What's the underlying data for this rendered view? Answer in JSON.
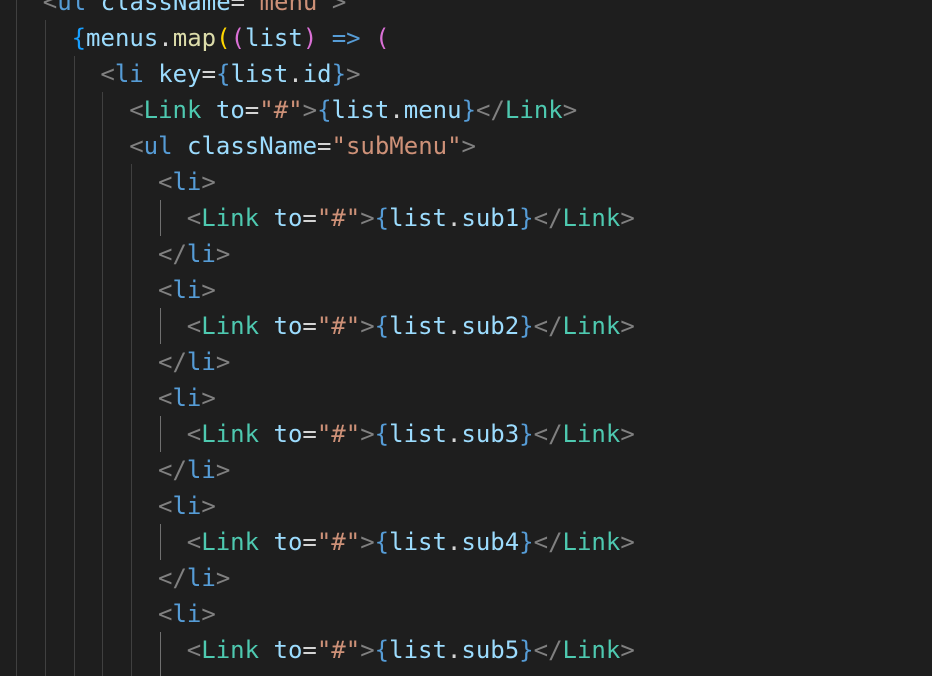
{
  "colors": {
    "background": "#1e1e1e",
    "tag_bracket": "#808080",
    "tag_name": "#569cd6",
    "component": "#4ec9b0",
    "attribute": "#9cdcfe",
    "string": "#ce9178",
    "punctuation": "#d4d4d4",
    "jsx_brace": "#569cd6",
    "bracket_gold": "#ffd700",
    "bracket_pink": "#da70d6",
    "bracket_blue": "#179fff",
    "function": "#dcdcaa"
  },
  "code_lines": [
    {
      "indent": 1,
      "tokens": [
        {
          "t": "<",
          "c": "tag_bracket"
        },
        {
          "t": "ul",
          "c": "tag_name"
        },
        {
          "t": " ",
          "c": "punctuation"
        },
        {
          "t": "className",
          "c": "attribute"
        },
        {
          "t": "=",
          "c": "punctuation"
        },
        {
          "t": "\"menu\"",
          "c": "string"
        },
        {
          "t": ">",
          "c": "tag_bracket"
        }
      ]
    },
    {
      "indent": 2,
      "tokens": [
        {
          "t": "{",
          "c": "bracket_blue"
        },
        {
          "t": "menus",
          "c": "attribute"
        },
        {
          "t": ".",
          "c": "punctuation"
        },
        {
          "t": "map",
          "c": "function"
        },
        {
          "t": "(",
          "c": "bracket_gold"
        },
        {
          "t": "(",
          "c": "bracket_pink"
        },
        {
          "t": "list",
          "c": "attribute"
        },
        {
          "t": ")",
          "c": "bracket_pink"
        },
        {
          "t": " ",
          "c": "punctuation"
        },
        {
          "t": "=>",
          "c": "tag_name"
        },
        {
          "t": " ",
          "c": "punctuation"
        },
        {
          "t": "(",
          "c": "bracket_pink"
        }
      ]
    },
    {
      "indent": 3,
      "tokens": [
        {
          "t": "<",
          "c": "tag_bracket"
        },
        {
          "t": "li",
          "c": "tag_name"
        },
        {
          "t": " ",
          "c": "punctuation"
        },
        {
          "t": "key",
          "c": "attribute"
        },
        {
          "t": "=",
          "c": "punctuation"
        },
        {
          "t": "{",
          "c": "jsx_brace"
        },
        {
          "t": "list",
          "c": "attribute"
        },
        {
          "t": ".",
          "c": "punctuation"
        },
        {
          "t": "id",
          "c": "attribute"
        },
        {
          "t": "}",
          "c": "jsx_brace"
        },
        {
          "t": ">",
          "c": "tag_bracket"
        }
      ]
    },
    {
      "indent": 4,
      "tokens": [
        {
          "t": "<",
          "c": "tag_bracket"
        },
        {
          "t": "Link",
          "c": "component"
        },
        {
          "t": " ",
          "c": "punctuation"
        },
        {
          "t": "to",
          "c": "attribute"
        },
        {
          "t": "=",
          "c": "punctuation"
        },
        {
          "t": "\"#\"",
          "c": "string"
        },
        {
          "t": ">",
          "c": "tag_bracket"
        },
        {
          "t": "{",
          "c": "jsx_brace"
        },
        {
          "t": "list",
          "c": "attribute"
        },
        {
          "t": ".",
          "c": "punctuation"
        },
        {
          "t": "menu",
          "c": "attribute"
        },
        {
          "t": "}",
          "c": "jsx_brace"
        },
        {
          "t": "</",
          "c": "tag_bracket"
        },
        {
          "t": "Link",
          "c": "component"
        },
        {
          "t": ">",
          "c": "tag_bracket"
        }
      ]
    },
    {
      "indent": 4,
      "tokens": [
        {
          "t": "<",
          "c": "tag_bracket"
        },
        {
          "t": "ul",
          "c": "tag_name"
        },
        {
          "t": " ",
          "c": "punctuation"
        },
        {
          "t": "className",
          "c": "attribute"
        },
        {
          "t": "=",
          "c": "punctuation"
        },
        {
          "t": "\"subMenu\"",
          "c": "string"
        },
        {
          "t": ">",
          "c": "tag_bracket"
        }
      ]
    },
    {
      "indent": 5,
      "tokens": [
        {
          "t": "<",
          "c": "tag_bracket"
        },
        {
          "t": "li",
          "c": "tag_name"
        },
        {
          "t": ">",
          "c": "tag_bracket"
        }
      ]
    },
    {
      "indent": 6,
      "tokens": [
        {
          "t": "<",
          "c": "tag_bracket"
        },
        {
          "t": "Link",
          "c": "component"
        },
        {
          "t": " ",
          "c": "punctuation"
        },
        {
          "t": "to",
          "c": "attribute"
        },
        {
          "t": "=",
          "c": "punctuation"
        },
        {
          "t": "\"#\"",
          "c": "string"
        },
        {
          "t": ">",
          "c": "tag_bracket"
        },
        {
          "t": "{",
          "c": "jsx_brace"
        },
        {
          "t": "list",
          "c": "attribute"
        },
        {
          "t": ".",
          "c": "punctuation"
        },
        {
          "t": "sub1",
          "c": "attribute"
        },
        {
          "t": "}",
          "c": "jsx_brace"
        },
        {
          "t": "</",
          "c": "tag_bracket"
        },
        {
          "t": "Link",
          "c": "component"
        },
        {
          "t": ">",
          "c": "tag_bracket"
        }
      ]
    },
    {
      "indent": 5,
      "tokens": [
        {
          "t": "</",
          "c": "tag_bracket"
        },
        {
          "t": "li",
          "c": "tag_name"
        },
        {
          "t": ">",
          "c": "tag_bracket"
        }
      ]
    },
    {
      "indent": 5,
      "tokens": [
        {
          "t": "<",
          "c": "tag_bracket"
        },
        {
          "t": "li",
          "c": "tag_name"
        },
        {
          "t": ">",
          "c": "tag_bracket"
        }
      ]
    },
    {
      "indent": 6,
      "tokens": [
        {
          "t": "<",
          "c": "tag_bracket"
        },
        {
          "t": "Link",
          "c": "component"
        },
        {
          "t": " ",
          "c": "punctuation"
        },
        {
          "t": "to",
          "c": "attribute"
        },
        {
          "t": "=",
          "c": "punctuation"
        },
        {
          "t": "\"#\"",
          "c": "string"
        },
        {
          "t": ">",
          "c": "tag_bracket"
        },
        {
          "t": "{",
          "c": "jsx_brace"
        },
        {
          "t": "list",
          "c": "attribute"
        },
        {
          "t": ".",
          "c": "punctuation"
        },
        {
          "t": "sub2",
          "c": "attribute"
        },
        {
          "t": "}",
          "c": "jsx_brace"
        },
        {
          "t": "</",
          "c": "tag_bracket"
        },
        {
          "t": "Link",
          "c": "component"
        },
        {
          "t": ">",
          "c": "tag_bracket"
        }
      ]
    },
    {
      "indent": 5,
      "tokens": [
        {
          "t": "</",
          "c": "tag_bracket"
        },
        {
          "t": "li",
          "c": "tag_name"
        },
        {
          "t": ">",
          "c": "tag_bracket"
        }
      ]
    },
    {
      "indent": 5,
      "tokens": [
        {
          "t": "<",
          "c": "tag_bracket"
        },
        {
          "t": "li",
          "c": "tag_name"
        },
        {
          "t": ">",
          "c": "tag_bracket"
        }
      ]
    },
    {
      "indent": 6,
      "tokens": [
        {
          "t": "<",
          "c": "tag_bracket"
        },
        {
          "t": "Link",
          "c": "component"
        },
        {
          "t": " ",
          "c": "punctuation"
        },
        {
          "t": "to",
          "c": "attribute"
        },
        {
          "t": "=",
          "c": "punctuation"
        },
        {
          "t": "\"#\"",
          "c": "string"
        },
        {
          "t": ">",
          "c": "tag_bracket"
        },
        {
          "t": "{",
          "c": "jsx_brace"
        },
        {
          "t": "list",
          "c": "attribute"
        },
        {
          "t": ".",
          "c": "punctuation"
        },
        {
          "t": "sub3",
          "c": "attribute"
        },
        {
          "t": "}",
          "c": "jsx_brace"
        },
        {
          "t": "</",
          "c": "tag_bracket"
        },
        {
          "t": "Link",
          "c": "component"
        },
        {
          "t": ">",
          "c": "tag_bracket"
        }
      ]
    },
    {
      "indent": 5,
      "tokens": [
        {
          "t": "</",
          "c": "tag_bracket"
        },
        {
          "t": "li",
          "c": "tag_name"
        },
        {
          "t": ">",
          "c": "tag_bracket"
        }
      ]
    },
    {
      "indent": 5,
      "tokens": [
        {
          "t": "<",
          "c": "tag_bracket"
        },
        {
          "t": "li",
          "c": "tag_name"
        },
        {
          "t": ">",
          "c": "tag_bracket"
        }
      ]
    },
    {
      "indent": 6,
      "tokens": [
        {
          "t": "<",
          "c": "tag_bracket"
        },
        {
          "t": "Link",
          "c": "component"
        },
        {
          "t": " ",
          "c": "punctuation"
        },
        {
          "t": "to",
          "c": "attribute"
        },
        {
          "t": "=",
          "c": "punctuation"
        },
        {
          "t": "\"#\"",
          "c": "string"
        },
        {
          "t": ">",
          "c": "tag_bracket"
        },
        {
          "t": "{",
          "c": "jsx_brace"
        },
        {
          "t": "list",
          "c": "attribute"
        },
        {
          "t": ".",
          "c": "punctuation"
        },
        {
          "t": "sub4",
          "c": "attribute"
        },
        {
          "t": "}",
          "c": "jsx_brace"
        },
        {
          "t": "</",
          "c": "tag_bracket"
        },
        {
          "t": "Link",
          "c": "component"
        },
        {
          "t": ">",
          "c": "tag_bracket"
        }
      ]
    },
    {
      "indent": 5,
      "tokens": [
        {
          "t": "</",
          "c": "tag_bracket"
        },
        {
          "t": "li",
          "c": "tag_name"
        },
        {
          "t": ">",
          "c": "tag_bracket"
        }
      ]
    },
    {
      "indent": 5,
      "tokens": [
        {
          "t": "<",
          "c": "tag_bracket"
        },
        {
          "t": "li",
          "c": "tag_name"
        },
        {
          "t": ">",
          "c": "tag_bracket"
        }
      ]
    },
    {
      "indent": 6,
      "tokens": [
        {
          "t": "<",
          "c": "tag_bracket"
        },
        {
          "t": "Link",
          "c": "component"
        },
        {
          "t": " ",
          "c": "punctuation"
        },
        {
          "t": "to",
          "c": "attribute"
        },
        {
          "t": "=",
          "c": "punctuation"
        },
        {
          "t": "\"#\"",
          "c": "string"
        },
        {
          "t": ">",
          "c": "tag_bracket"
        },
        {
          "t": "{",
          "c": "jsx_brace"
        },
        {
          "t": "list",
          "c": "attribute"
        },
        {
          "t": ".",
          "c": "punctuation"
        },
        {
          "t": "sub5",
          "c": "attribute"
        },
        {
          "t": "}",
          "c": "jsx_brace"
        },
        {
          "t": "</",
          "c": "tag_bracket"
        },
        {
          "t": "Link",
          "c": "component"
        },
        {
          "t": ">",
          "c": "tag_bracket"
        }
      ]
    }
  ]
}
